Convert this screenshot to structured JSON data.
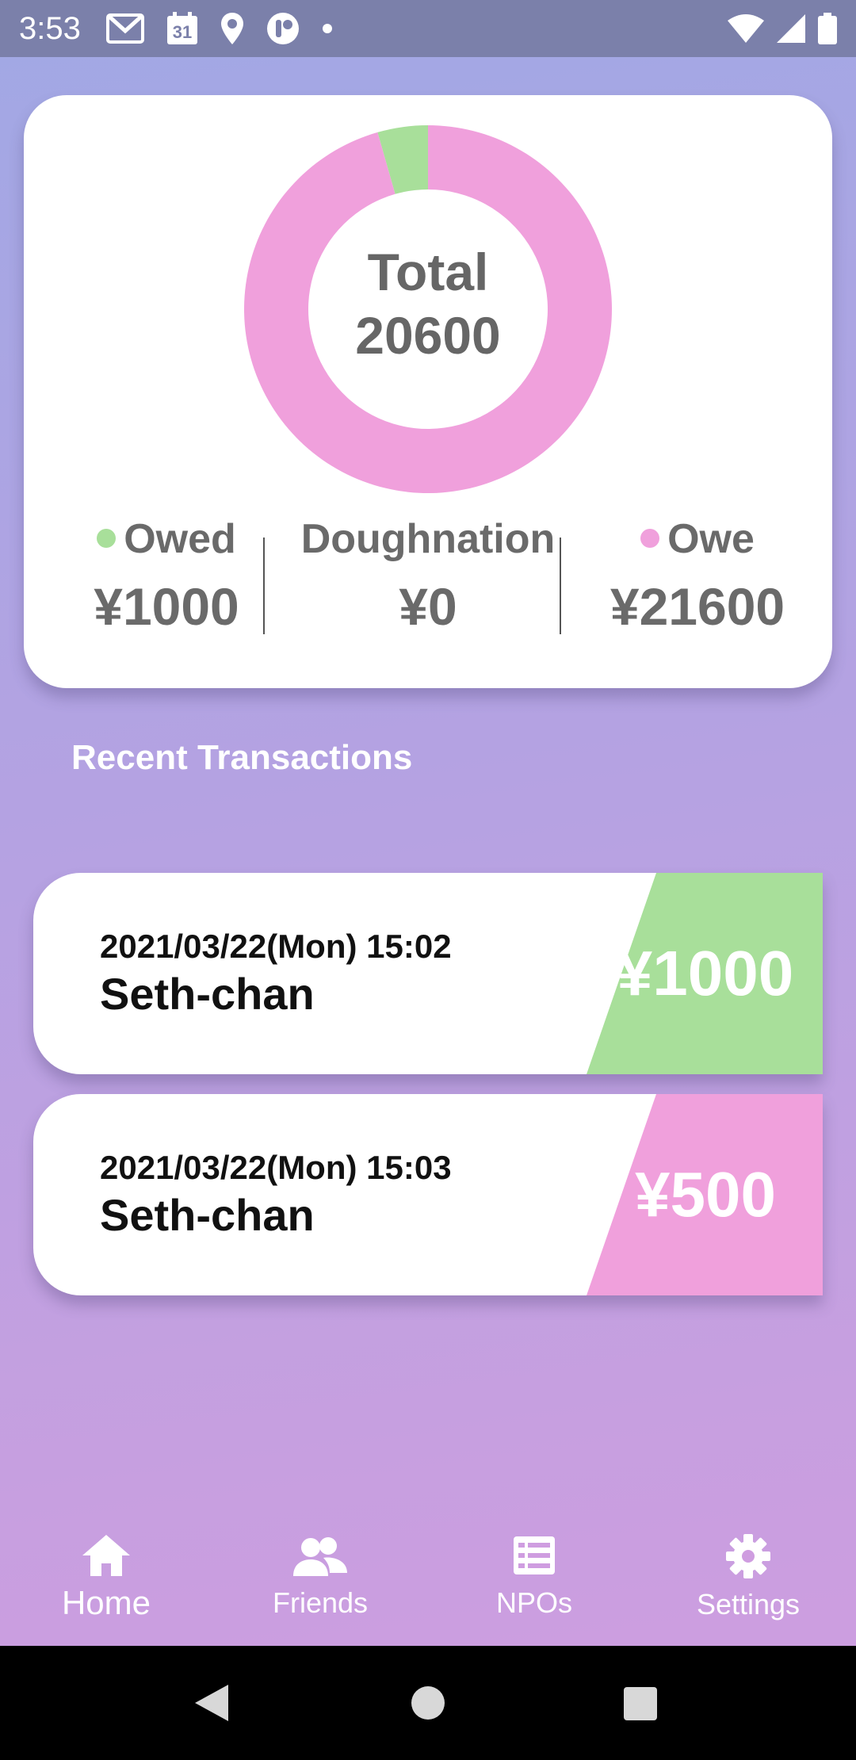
{
  "status_bar": {
    "time": "3:53",
    "left_icons": [
      "gmail-icon",
      "calendar-icon",
      "location-icon",
      "app-icon",
      "dot-icon"
    ],
    "calendar_day": "31",
    "right_icons": [
      "wifi-icon",
      "signal-icon",
      "battery-icon"
    ]
  },
  "summary": {
    "total_label": "Total",
    "total_value": "20600",
    "donut": {
      "segments": [
        {
          "name": "Owed",
          "value": 1000,
          "color": "#a8df9a"
        },
        {
          "name": "Owe",
          "value": 21600,
          "color": "#f0a0dc"
        }
      ]
    },
    "stats": {
      "owed": {
        "label": "Owed",
        "value": "¥1000",
        "dot_color": "#a8df9a"
      },
      "doughnation": {
        "label": "Doughnation",
        "value": "¥0"
      },
      "owe": {
        "label": "Owe",
        "value": "¥21600",
        "dot_color": "#f0a0dc"
      }
    }
  },
  "recent": {
    "title": "Recent Transactions",
    "transactions": [
      {
        "date": "2021/03/22(Mon) 15:02",
        "name": "Seth-chan",
        "amount": "¥1000",
        "color": "#a8df9a"
      },
      {
        "date": "2021/03/22(Mon) 15:03",
        "name": "Seth-chan",
        "amount": "¥500",
        "color": "#f0a0dc"
      }
    ]
  },
  "nav": {
    "items": [
      {
        "label": "Home",
        "icon": "home-icon",
        "active": true
      },
      {
        "label": "Friends",
        "icon": "friends-icon",
        "active": false
      },
      {
        "label": "NPOs",
        "icon": "list-icon",
        "active": false
      },
      {
        "label": "Settings",
        "icon": "gear-icon",
        "active": false
      }
    ]
  },
  "system_nav": [
    "back-icon",
    "home-circle-icon",
    "recents-icon"
  ]
}
